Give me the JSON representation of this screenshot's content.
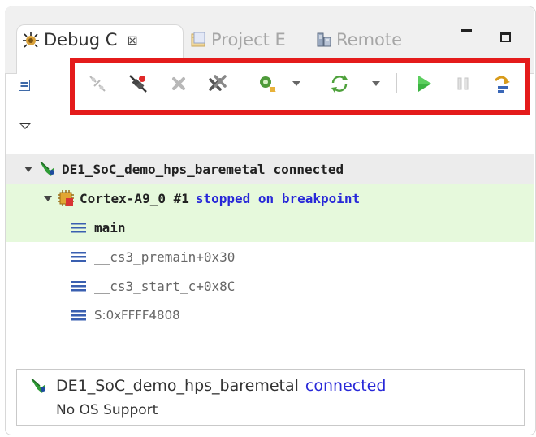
{
  "tabs": [
    {
      "label": "Debug C",
      "icon": "debug-bug-icon",
      "active": true,
      "close": "⊠"
    },
    {
      "label": "Project E",
      "icon": "project-folder-icon",
      "active": false
    },
    {
      "label": "Remote",
      "icon": "remote-systems-icon",
      "active": false
    }
  ],
  "window_controls": {
    "minimize": "minimize-icon",
    "maximize": "maximize-icon"
  },
  "toolbar": {
    "highlight_color": "#e41b1b",
    "tools": [
      {
        "name": "connect-to-target-icon",
        "enabled": false
      },
      {
        "name": "disconnect-from-target-icon",
        "enabled": true
      },
      {
        "name": "remove-connection-icon",
        "enabled": false
      },
      {
        "name": "remove-all-connections-icon",
        "enabled": true
      },
      {
        "name": "debug-configuration-icon",
        "enabled": true
      },
      {
        "name": "reconnect-icon",
        "enabled": true
      },
      {
        "name": "resume-icon",
        "enabled": true
      },
      {
        "name": "suspend-icon",
        "enabled": false
      },
      {
        "name": "step-over-icon",
        "enabled": true
      }
    ]
  },
  "tree": {
    "root": {
      "name": "DE1_SoC_demo_hps_baremetal",
      "status": "connected"
    },
    "thread": {
      "name": "Cortex-A9_0 #1",
      "status": "stopped on breakpoint"
    },
    "frames": [
      {
        "label": "main",
        "active": true
      },
      {
        "label": "__cs3_premain+0x30",
        "active": false
      },
      {
        "label": "__cs3_start_c+0x8C",
        "active": false
      },
      {
        "label": "S:0xFFFF4808",
        "active": false
      }
    ]
  },
  "details": {
    "name": "DE1_SoC_demo_hps_baremetal",
    "status": "connected",
    "os": "No OS Support"
  },
  "colors": {
    "accent_blue": "#2828d8",
    "thread_bg": "#e6f9dc",
    "root_bg": "#ececec",
    "highlight_red": "#e41b1b"
  }
}
